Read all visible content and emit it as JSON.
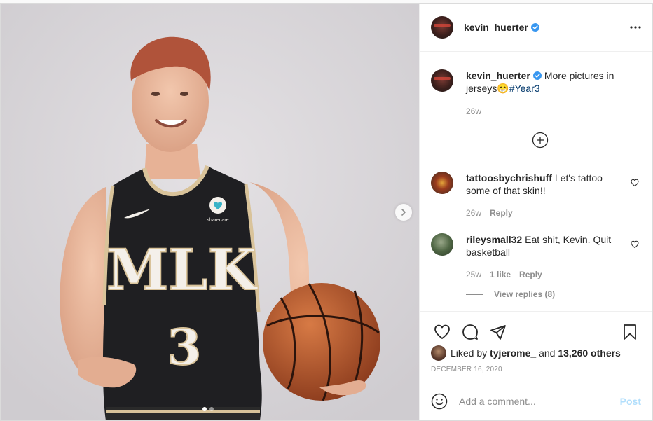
{
  "post": {
    "author": "kevin_huerter",
    "caption": {
      "text": "More pictures in jerseys",
      "emoji": "😁",
      "hashtag": "#Year3",
      "age": "26w"
    },
    "likes": {
      "prefix": "Liked by ",
      "user": "tyjerome_",
      "middle": " and ",
      "count": "13,260 others"
    },
    "date": "DECEMBER 16, 2020",
    "carousel": {
      "total": 2,
      "active": 0
    }
  },
  "comments": [
    {
      "username": "tattoosbychrishuff",
      "text": "Let's tattoo some of that skin!!",
      "age": "26w",
      "likes": "",
      "reply_label": "Reply"
    },
    {
      "username": "rileysmall32",
      "text": "Eat shit, Kevin. Quit basketball",
      "age": "25w",
      "likes": "1 like",
      "reply_label": "Reply",
      "view_replies": "View replies (8)"
    }
  ],
  "composer": {
    "placeholder": "Add a comment...",
    "post_label": "Post"
  },
  "jersey": {
    "wordmark": "MLK",
    "number": "3",
    "sponsor": "sharecare"
  }
}
